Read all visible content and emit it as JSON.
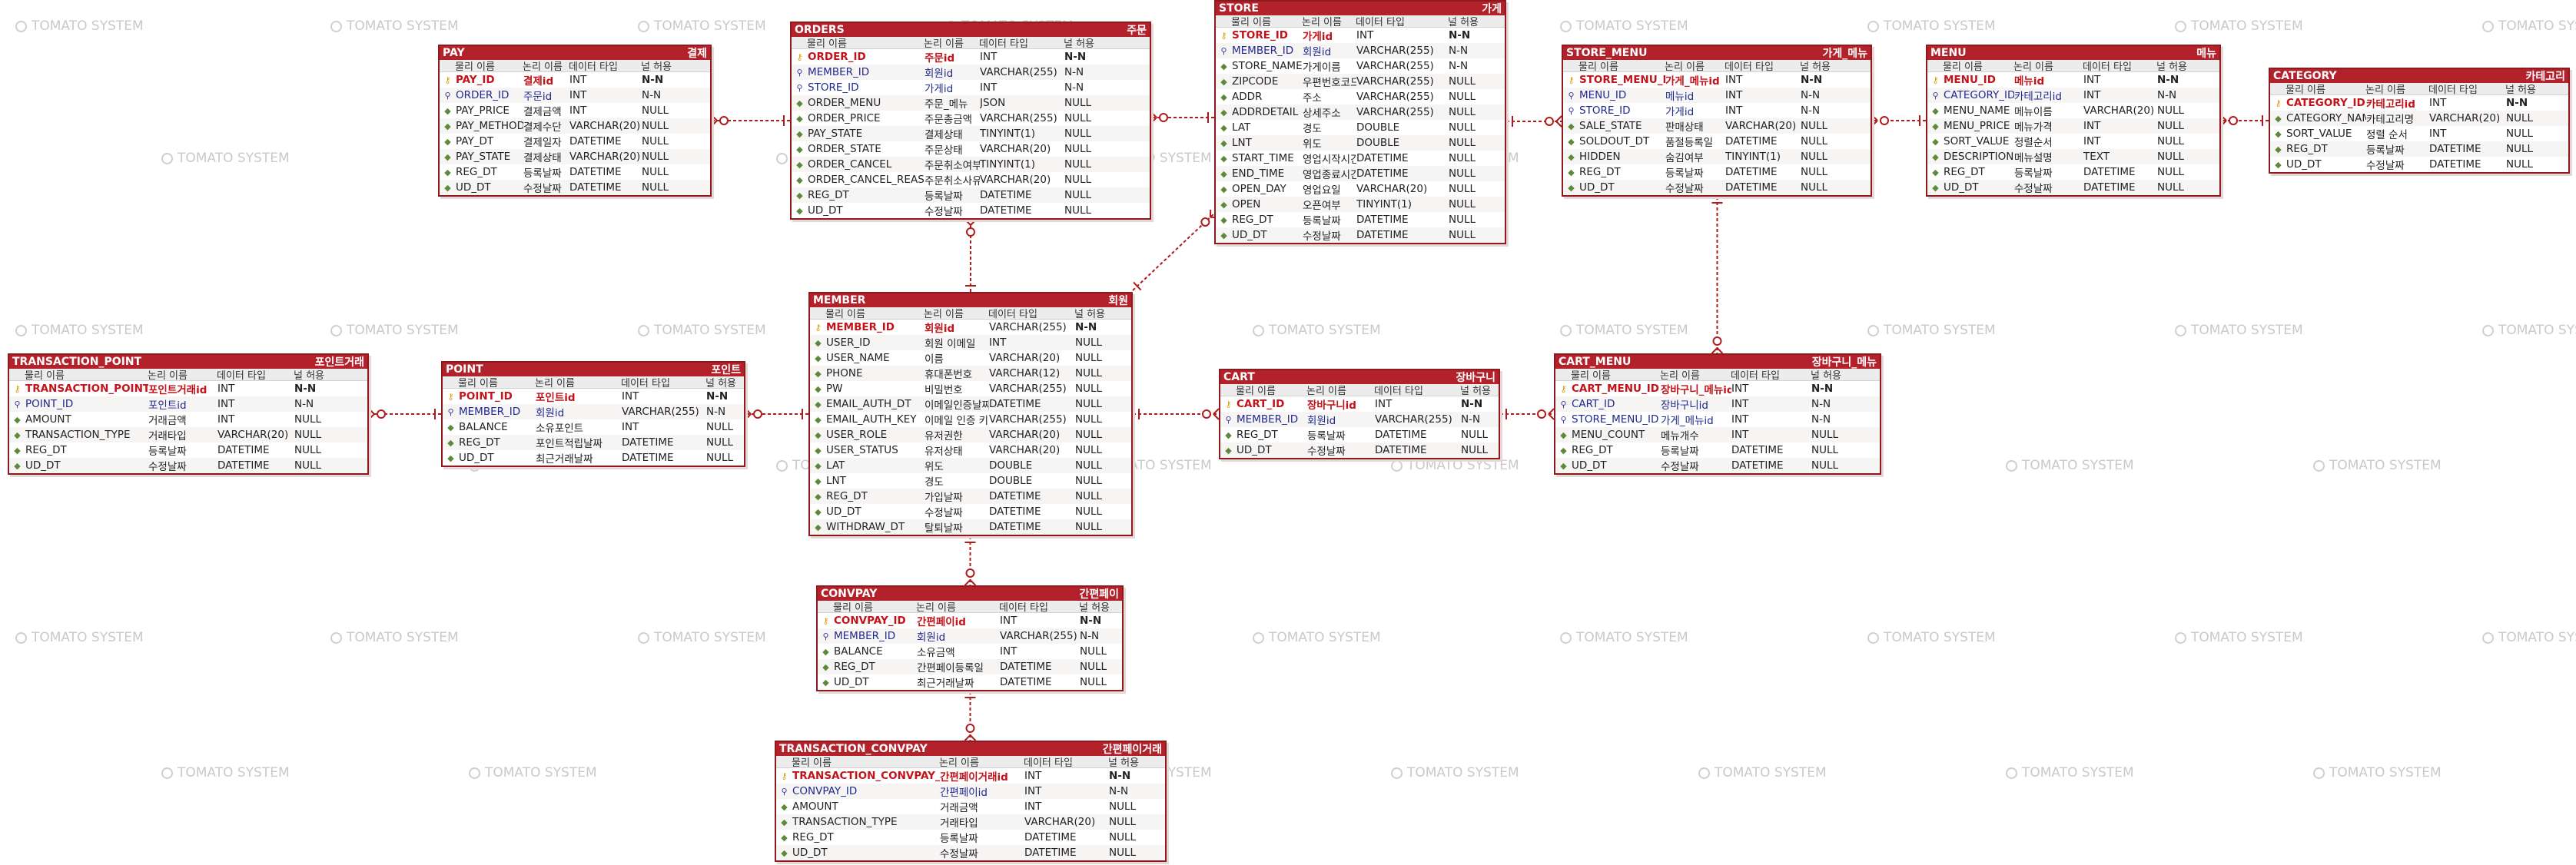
{
  "watermark": "TOMATO SYSTEM",
  "colors": {
    "header": "#b3212b",
    "border": "#8c1a1f",
    "relation": "#b11a1a",
    "pk": "#c0141a",
    "fk": "#1f2a8c"
  },
  "column_headers": [
    "물리 이름",
    "논리 이름",
    "데이터 타입",
    "널 허용"
  ],
  "tables": [
    {
      "id": "pay",
      "name": "PAY",
      "label": "결제",
      "rows": [
        [
          "pk",
          "PAY_ID",
          "결제id",
          "INT",
          "N-N"
        ],
        [
          "fk",
          "ORDER_ID",
          "주문id",
          "INT",
          "N-N"
        ],
        [
          "col",
          "PAY_PRICE",
          "결제금액",
          "INT",
          "NULL"
        ],
        [
          "col",
          "PAY_METHOD",
          "결제수단",
          "VARCHAR(20)",
          "NULL"
        ],
        [
          "col",
          "PAY_DT",
          "결제일자",
          "DATETIME",
          "NULL"
        ],
        [
          "col",
          "PAY_STATE",
          "결제상태",
          "VARCHAR(20)",
          "NULL"
        ],
        [
          "col",
          "REG_DT",
          "등록날짜",
          "DATETIME",
          "NULL"
        ],
        [
          "col",
          "UD_DT",
          "수정날짜",
          "DATETIME",
          "NULL"
        ]
      ]
    },
    {
      "id": "orders",
      "name": "ORDERS",
      "label": "주문",
      "rows": [
        [
          "pk",
          "ORDER_ID",
          "주문id",
          "INT",
          "N-N"
        ],
        [
          "fk",
          "MEMBER_ID",
          "회원id",
          "VARCHAR(255)",
          "N-N"
        ],
        [
          "fk",
          "STORE_ID",
          "가게id",
          "INT",
          "N-N"
        ],
        [
          "col",
          "ORDER_MENU",
          "주문_메뉴",
          "JSON",
          "NULL"
        ],
        [
          "col",
          "ORDER_PRICE",
          "주문총금액",
          "VARCHAR(255)",
          "NULL"
        ],
        [
          "col",
          "PAY_STATE",
          "결제상태",
          "TINYINT(1)",
          "NULL"
        ],
        [
          "col",
          "ORDER_STATE",
          "주문상태",
          "VARCHAR(20)",
          "NULL"
        ],
        [
          "col",
          "ORDER_CANCEL",
          "주문취소여부",
          "TINYINT(1)",
          "NULL"
        ],
        [
          "col",
          "ORDER_CANCEL_REASON",
          "주문취소사유",
          "VARCHAR(20)",
          "NULL"
        ],
        [
          "col",
          "REG_DT",
          "등록날짜",
          "DATETIME",
          "NULL"
        ],
        [
          "col",
          "UD_DT",
          "수정날짜",
          "DATETIME",
          "NULL"
        ]
      ]
    },
    {
      "id": "store",
      "name": "STORE",
      "label": "가게",
      "rows": [
        [
          "pk",
          "STORE_ID",
          "가게id",
          "INT",
          "N-N"
        ],
        [
          "fk",
          "MEMBER_ID",
          "회원id",
          "VARCHAR(255)",
          "N-N"
        ],
        [
          "col",
          "STORE_NAME",
          "가게이름",
          "VARCHAR(255)",
          "N-N"
        ],
        [
          "col",
          "ZIPCODE",
          "우편번호코드",
          "VARCHAR(255)",
          "NULL"
        ],
        [
          "col",
          "ADDR",
          "주소",
          "VARCHAR(255)",
          "NULL"
        ],
        [
          "col",
          "ADDRDETAIL",
          "상세주소",
          "VARCHAR(255)",
          "NULL"
        ],
        [
          "col",
          "LAT",
          "경도",
          "DOUBLE",
          "NULL"
        ],
        [
          "col",
          "LNT",
          "위도",
          "DOUBLE",
          "NULL"
        ],
        [
          "col",
          "START_TIME",
          "영업시작시간",
          "DATETIME",
          "NULL"
        ],
        [
          "col",
          "END_TIME",
          "영업종료시간",
          "DATETIME",
          "NULL"
        ],
        [
          "col",
          "OPEN_DAY",
          "영업요일",
          "VARCHAR(20)",
          "NULL"
        ],
        [
          "col",
          "OPEN",
          "오픈여부",
          "TINYINT(1)",
          "NULL"
        ],
        [
          "col",
          "REG_DT",
          "등록날짜",
          "DATETIME",
          "NULL"
        ],
        [
          "col",
          "UD_DT",
          "수정날짜",
          "DATETIME",
          "NULL"
        ]
      ]
    },
    {
      "id": "store_menu",
      "name": "STORE_MENU",
      "label": "가게_메뉴",
      "rows": [
        [
          "pk",
          "STORE_MENU_ID",
          "가게_메뉴id",
          "INT",
          "N-N"
        ],
        [
          "fk",
          "MENU_ID",
          "메뉴id",
          "INT",
          "N-N"
        ],
        [
          "fk",
          "STORE_ID",
          "가게id",
          "INT",
          "N-N"
        ],
        [
          "col",
          "SALE_STATE",
          "판매상태",
          "VARCHAR(20)",
          "NULL"
        ],
        [
          "col",
          "SOLDOUT_DT",
          "품절등록일",
          "DATETIME",
          "NULL"
        ],
        [
          "col",
          "HIDDEN",
          "숨김여부",
          "TINYINT(1)",
          "NULL"
        ],
        [
          "col",
          "REG_DT",
          "등록날짜",
          "DATETIME",
          "NULL"
        ],
        [
          "col",
          "UD_DT",
          "수정날짜",
          "DATETIME",
          "NULL"
        ]
      ]
    },
    {
      "id": "menu",
      "name": "MENU",
      "label": "메뉴",
      "rows": [
        [
          "pk",
          "MENU_ID",
          "메뉴id",
          "INT",
          "N-N"
        ],
        [
          "fk",
          "CATEGORY_ID",
          "카테고리id",
          "INT",
          "N-N"
        ],
        [
          "col",
          "MENU_NAME",
          "메뉴이름",
          "VARCHAR(20)",
          "NULL"
        ],
        [
          "col",
          "MENU_PRICE",
          "메뉴가격",
          "INT",
          "NULL"
        ],
        [
          "col",
          "SORT_VALUE",
          "정렬순서",
          "INT",
          "NULL"
        ],
        [
          "col",
          "DESCRIPTION",
          "메뉴설명",
          "TEXT",
          "NULL"
        ],
        [
          "col",
          "REG_DT",
          "등록날짜",
          "DATETIME",
          "NULL"
        ],
        [
          "col",
          "UD_DT",
          "수정날짜",
          "DATETIME",
          "NULL"
        ]
      ]
    },
    {
      "id": "category",
      "name": "CATEGORY",
      "label": "카테고리",
      "rows": [
        [
          "pk",
          "CATEGORY_ID",
          "카테고리id",
          "INT",
          "N-N"
        ],
        [
          "col",
          "CATEGORY_NAME",
          "카테고리명",
          "VARCHAR(20)",
          "NULL"
        ],
        [
          "col",
          "SORT_VALUE",
          "정렬 순서",
          "INT",
          "NULL"
        ],
        [
          "col",
          "REG_DT",
          "등록날짜",
          "DATETIME",
          "NULL"
        ],
        [
          "col",
          "UD_DT",
          "수정날짜",
          "DATETIME",
          "NULL"
        ]
      ]
    },
    {
      "id": "member",
      "name": "MEMBER",
      "label": "회원",
      "rows": [
        [
          "pk",
          "MEMBER_ID",
          "회원id",
          "VARCHAR(255)",
          "N-N"
        ],
        [
          "col",
          "USER_ID",
          "회원 이메일",
          "INT",
          "NULL"
        ],
        [
          "col",
          "USER_NAME",
          "이름",
          "VARCHAR(20)",
          "NULL"
        ],
        [
          "col",
          "PHONE",
          "휴대폰번호",
          "VARCHAR(12)",
          "NULL"
        ],
        [
          "col",
          "PW",
          "비밀번호",
          "VARCHAR(255)",
          "NULL"
        ],
        [
          "col",
          "EMAIL_AUTH_DT",
          "이메일인증날짜",
          "DATETIME",
          "NULL"
        ],
        [
          "col",
          "EMAIL_AUTH_KEY",
          "이메일 인증 키",
          "VARCHAR(255)",
          "NULL"
        ],
        [
          "col",
          "USER_ROLE",
          "유저권한",
          "VARCHAR(20)",
          "NULL"
        ],
        [
          "col",
          "USER_STATUS",
          "유저상태",
          "VARCHAR(20)",
          "NULL"
        ],
        [
          "col",
          "LAT",
          "위도",
          "DOUBLE",
          "NULL"
        ],
        [
          "col",
          "LNT",
          "경도",
          "DOUBLE",
          "NULL"
        ],
        [
          "col",
          "REG_DT",
          "가입날짜",
          "DATETIME",
          "NULL"
        ],
        [
          "col",
          "UD_DT",
          "수정날짜",
          "DATETIME",
          "NULL"
        ],
        [
          "col",
          "WITHDRAW_DT",
          "탈퇴날짜",
          "DATETIME",
          "NULL"
        ]
      ]
    },
    {
      "id": "transaction_point",
      "name": "TRANSACTION_POINT",
      "label": "포인트거래",
      "rows": [
        [
          "pk",
          "TRANSACTION_POINT_ID",
          "포인트거래id",
          "INT",
          "N-N"
        ],
        [
          "fk",
          "POINT_ID",
          "포인트id",
          "INT",
          "N-N"
        ],
        [
          "col",
          "AMOUNT",
          "거래금액",
          "INT",
          "NULL"
        ],
        [
          "col",
          "TRANSACTION_TYPE",
          "거래타입",
          "VARCHAR(20)",
          "NULL"
        ],
        [
          "col",
          "REG_DT",
          "등록날짜",
          "DATETIME",
          "NULL"
        ],
        [
          "col",
          "UD_DT",
          "수정날짜",
          "DATETIME",
          "NULL"
        ]
      ]
    },
    {
      "id": "point",
      "name": "POINT",
      "label": "포인트",
      "rows": [
        [
          "pk",
          "POINT_ID",
          "포인트id",
          "INT",
          "N-N"
        ],
        [
          "fk",
          "MEMBER_ID",
          "회원id",
          "VARCHAR(255)",
          "N-N"
        ],
        [
          "col",
          "BALANCE",
          "소유포인트",
          "INT",
          "NULL"
        ],
        [
          "col",
          "REG_DT",
          "포인트적립날짜",
          "DATETIME",
          "NULL"
        ],
        [
          "col",
          "UD_DT",
          "최근거래날짜",
          "DATETIME",
          "NULL"
        ]
      ]
    },
    {
      "id": "cart",
      "name": "CART",
      "label": "장바구니",
      "rows": [
        [
          "pk",
          "CART_ID",
          "장바구니id",
          "INT",
          "N-N"
        ],
        [
          "fk",
          "MEMBER_ID",
          "회원id",
          "VARCHAR(255)",
          "N-N"
        ],
        [
          "col",
          "REG_DT",
          "등록날짜",
          "DATETIME",
          "NULL"
        ],
        [
          "col",
          "UD_DT",
          "수정날짜",
          "DATETIME",
          "NULL"
        ]
      ]
    },
    {
      "id": "cart_menu",
      "name": "CART_MENU",
      "label": "장바구니_메뉴",
      "rows": [
        [
          "pk",
          "CART_MENU_ID",
          "장바구니_메뉴id",
          "INT",
          "N-N"
        ],
        [
          "fk",
          "CART_ID",
          "장바구니id",
          "INT",
          "N-N"
        ],
        [
          "fk",
          "STORE_MENU_ID",
          "가게_메뉴id",
          "INT",
          "N-N"
        ],
        [
          "col",
          "MENU_COUNT",
          "메뉴개수",
          "INT",
          "NULL"
        ],
        [
          "col",
          "REG_DT",
          "등록날짜",
          "DATETIME",
          "NULL"
        ],
        [
          "col",
          "UD_DT",
          "수정날짜",
          "DATETIME",
          "NULL"
        ]
      ]
    },
    {
      "id": "convpay",
      "name": "CONVPAY",
      "label": "간편페이",
      "rows": [
        [
          "pk",
          "CONVPAY_ID",
          "간편페이id",
          "INT",
          "N-N"
        ],
        [
          "fk",
          "MEMBER_ID",
          "회원id",
          "VARCHAR(255)",
          "N-N"
        ],
        [
          "col",
          "BALANCE",
          "소유금액",
          "INT",
          "NULL"
        ],
        [
          "col",
          "REG_DT",
          "간편페이등록일",
          "DATETIME",
          "NULL"
        ],
        [
          "col",
          "UD_DT",
          "최근거래날짜",
          "DATETIME",
          "NULL"
        ]
      ]
    },
    {
      "id": "transaction_convpay",
      "name": "TRANSACTION_CONVPAY",
      "label": "간편페이거래",
      "rows": [
        [
          "pk",
          "TRANSACTION_CONVPAY_ID",
          "간편페이거래id",
          "INT",
          "N-N"
        ],
        [
          "fk",
          "CONVPAY_ID",
          "간편페이id",
          "INT",
          "N-N"
        ],
        [
          "col",
          "AMOUNT",
          "거래금액",
          "INT",
          "NULL"
        ],
        [
          "col",
          "TRANSACTION_TYPE",
          "거래타입",
          "VARCHAR(20)",
          "NULL"
        ],
        [
          "col",
          "REG_DT",
          "등록날짜",
          "DATETIME",
          "NULL"
        ],
        [
          "col",
          "UD_DT",
          "수정날짜",
          "DATETIME",
          "NULL"
        ]
      ]
    }
  ],
  "relationships": [
    {
      "from": "orders",
      "to": "pay"
    },
    {
      "from": "store",
      "to": "orders"
    },
    {
      "from": "member",
      "to": "orders"
    },
    {
      "from": "member",
      "to": "store"
    },
    {
      "from": "store",
      "to": "store_menu"
    },
    {
      "from": "menu",
      "to": "store_menu"
    },
    {
      "from": "category",
      "to": "menu"
    },
    {
      "from": "store_menu",
      "to": "cart_menu"
    },
    {
      "from": "cart",
      "to": "cart_menu"
    },
    {
      "from": "member",
      "to": "cart"
    },
    {
      "from": "member",
      "to": "point"
    },
    {
      "from": "point",
      "to": "transaction_point"
    },
    {
      "from": "member",
      "to": "convpay"
    },
    {
      "from": "convpay",
      "to": "transaction_convpay"
    }
  ]
}
